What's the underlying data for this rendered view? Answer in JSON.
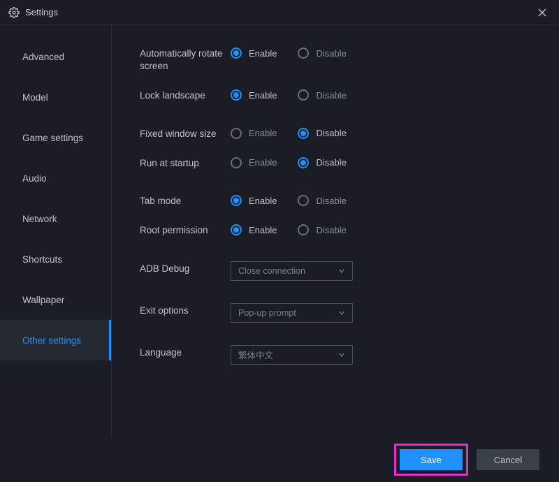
{
  "window": {
    "title": "Settings"
  },
  "sidebar": {
    "items": [
      {
        "label": "Advanced"
      },
      {
        "label": "Model"
      },
      {
        "label": "Game settings"
      },
      {
        "label": "Audio"
      },
      {
        "label": "Network"
      },
      {
        "label": "Shortcuts"
      },
      {
        "label": "Wallpaper"
      },
      {
        "label": "Other settings"
      }
    ],
    "active_index": 7
  },
  "options": {
    "enable": "Enable",
    "disable": "Disable"
  },
  "settings": [
    {
      "key": "auto_rotate",
      "label": "Automatically rotate screen",
      "selected": "enable"
    },
    {
      "key": "lock_landscape",
      "label": "Lock landscape",
      "selected": "enable"
    },
    {
      "key": "fixed_window_size",
      "label": "Fixed window size",
      "selected": "disable"
    },
    {
      "key": "run_at_startup",
      "label": "Run at startup",
      "selected": "disable"
    },
    {
      "key": "tab_mode",
      "label": "Tab mode",
      "selected": "enable"
    },
    {
      "key": "root_permission",
      "label": "Root permission",
      "selected": "enable"
    }
  ],
  "dropdowns": [
    {
      "key": "adb_debug",
      "label": "ADB Debug",
      "value": "Close connection"
    },
    {
      "key": "exit_options",
      "label": "Exit options",
      "value": "Pop-up prompt"
    },
    {
      "key": "language",
      "label": "Language",
      "value": "繁体中文"
    }
  ],
  "footer": {
    "save": "Save",
    "cancel": "Cancel"
  },
  "highlight": {
    "target": "save-button"
  }
}
